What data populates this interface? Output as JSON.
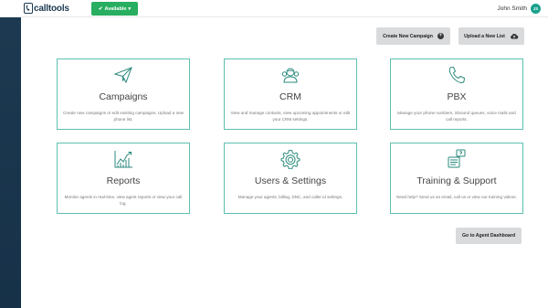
{
  "app": {
    "logo_text": "calltools"
  },
  "header": {
    "status_label": "Available",
    "user_name": "John Smith",
    "avatar_initials": "JS"
  },
  "actions": {
    "create_campaign": "Create New Campaign",
    "upload_list": "Upload a New List",
    "agent_dashboard": "Go to Agent Dashboard"
  },
  "cards": [
    {
      "title": "Campaigns",
      "description": "Create new campaigns or edit existing campaigns. Upload a new phone list.",
      "icon": "paper-plane-icon"
    },
    {
      "title": "CRM",
      "description": "View and manage contacts, view upcoming appointments or edit your CRM settings.",
      "icon": "contacts-icon"
    },
    {
      "title": "PBX",
      "description": "Manage your phone numbers, inbound queues, voice mails and call reports.",
      "icon": "phone-icon"
    },
    {
      "title": "Reports",
      "description": "Monitor agents in real-time, view agent reports or view your call log.",
      "icon": "chart-icon"
    },
    {
      "title": "Users & Settings",
      "description": "Manage your agents, billing, DNC, and caller id settings.",
      "icon": "gear-icon"
    },
    {
      "title": "Training & Support",
      "description": "Need help? Send us an email, call us or view our training videos.",
      "icon": "support-icon"
    }
  ],
  "colors": {
    "accent": "#27ae60",
    "card_border": "#5cc0b0",
    "sidebar": "#1d3a52",
    "icon_stroke": "#2a8a7c"
  }
}
